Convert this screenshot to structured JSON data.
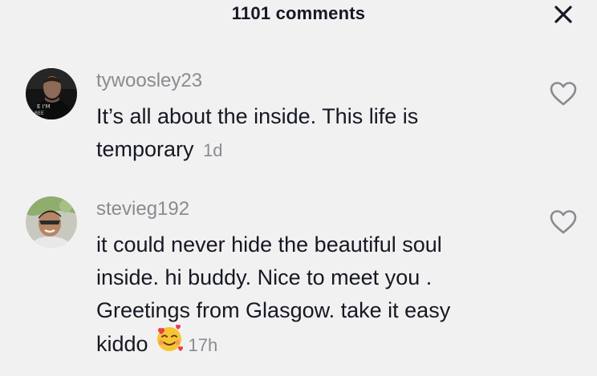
{
  "header": {
    "title": "1101 comments"
  },
  "comments": [
    {
      "username": "tywoosley23",
      "text": "It’s all about the inside. This life is temporary",
      "time": "1d"
    },
    {
      "username": "stevieg192",
      "text": "it could never hide the beautiful soul inside. hi buddy. Nice to meet you . Greetings from Glasgow. take it easy kiddo",
      "time": "17h"
    }
  ],
  "icons": {
    "close": "close-icon",
    "like": "heart-outline-icon",
    "emoji": "smiling-face-with-hearts-emoji"
  },
  "colors": {
    "background": "#f1f1f2",
    "text": "#161823",
    "muted": "#8a8b91"
  }
}
